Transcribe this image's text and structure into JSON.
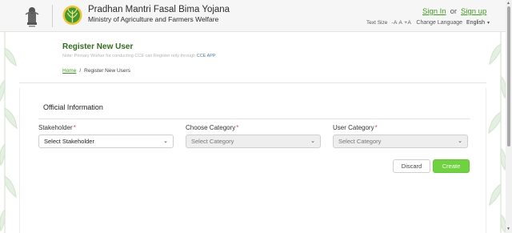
{
  "header": {
    "title": "Pradhan Mantri Fasal Bima Yojana",
    "subtitle": "Ministry of Agriculture and Farmers Welfare",
    "sign_in": "Sign In",
    "or": "or",
    "sign_up": "Sign up",
    "text_size_label": "Text Size",
    "text_sizes": "-A A +A",
    "change_language": "Change Language",
    "language": "English"
  },
  "page": {
    "title": "Register New User",
    "note": "Note: Primary Worker for conducting CCE can Register only through",
    "note_link": "CCE APP",
    "breadcrumb": {
      "home": "Home",
      "separator": "/",
      "current": "Register New Users"
    }
  },
  "form": {
    "section_title": "Official Information",
    "required_mark": "*",
    "fields": [
      {
        "label": "Stakeholder",
        "value": "Select Stakeholder",
        "disabled": false
      },
      {
        "label": "Choose Category",
        "value": "Select Category",
        "disabled": true
      },
      {
        "label": "User Category",
        "value": "Select Category",
        "disabled": true
      }
    ],
    "discard_label": "Discard",
    "create_label": "Create"
  },
  "colors": {
    "accent_green": "#3e9c1b",
    "title_green": "#2f6d1a",
    "create_button": "#6fd23f",
    "required": "#d9534f"
  },
  "icons": {
    "emblem": "national-emblem-icon",
    "logo": "pmfby-logo-icon",
    "dropdown": "chevron-down-icon"
  }
}
